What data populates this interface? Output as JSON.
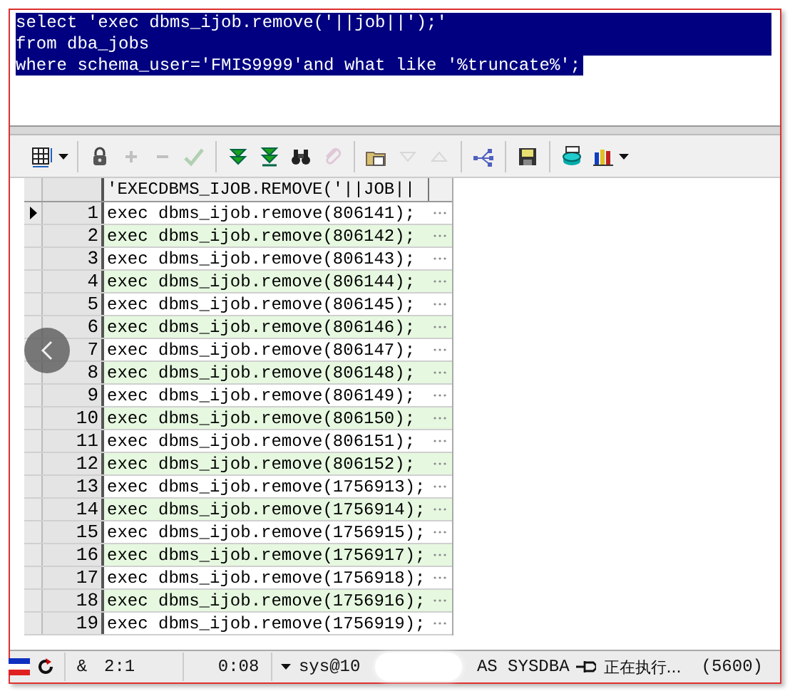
{
  "editor": {
    "lines": [
      {
        "text": "select 'exec dbms_ijob.remove('||job||');'",
        "selected": true
      },
      {
        "text": "from dba_jobs",
        "selected": true
      },
      {
        "text": "where schema_user='FMIS9999'and what like '%truncate%';",
        "selected": true
      }
    ]
  },
  "toolbar": {
    "groups": [
      [
        {
          "kind": "grid",
          "disabled": false,
          "dropdown": true
        }
      ],
      [
        {
          "kind": "lock",
          "disabled": false
        },
        {
          "kind": "plus",
          "disabled": true
        },
        {
          "kind": "minus",
          "disabled": true
        },
        {
          "kind": "check",
          "disabled": true
        }
      ],
      [
        {
          "kind": "fetch-next",
          "disabled": false
        },
        {
          "kind": "fetch-last",
          "disabled": false
        },
        {
          "kind": "binoculars",
          "disabled": false
        },
        {
          "kind": "clip",
          "disabled": true
        }
      ],
      [
        {
          "kind": "folder",
          "disabled": false
        },
        {
          "kind": "down",
          "disabled": true
        },
        {
          "kind": "up",
          "disabled": true
        }
      ],
      [
        {
          "kind": "network",
          "disabled": false
        }
      ],
      [
        {
          "kind": "save",
          "disabled": false
        }
      ],
      [
        {
          "kind": "database",
          "disabled": false
        },
        {
          "kind": "chart",
          "disabled": false,
          "dropdown": true
        }
      ]
    ]
  },
  "grid": {
    "columns": [
      "'EXECDBMS_IJOB.REMOVE('||JOB||"
    ],
    "rows": [
      {
        "number": "1",
        "value": "exec dbms_ijob.remove(806141);",
        "selected": true
      },
      {
        "number": "2",
        "value": "exec dbms_ijob.remove(806142);",
        "selected": false
      },
      {
        "number": "3",
        "value": "exec dbms_ijob.remove(806143);",
        "selected": false
      },
      {
        "number": "4",
        "value": "exec dbms_ijob.remove(806144);",
        "selected": false
      },
      {
        "number": "5",
        "value": "exec dbms_ijob.remove(806145);",
        "selected": false
      },
      {
        "number": "6",
        "value": "exec dbms_ijob.remove(806146);",
        "selected": false
      },
      {
        "number": "7",
        "value": "exec dbms_ijob.remove(806147);",
        "selected": false
      },
      {
        "number": "8",
        "value": "exec dbms_ijob.remove(806148);",
        "selected": false
      },
      {
        "number": "9",
        "value": "exec dbms_ijob.remove(806149);",
        "selected": false
      },
      {
        "number": "10",
        "value": "exec dbms_ijob.remove(806150);",
        "selected": false
      },
      {
        "number": "11",
        "value": "exec dbms_ijob.remove(806151);",
        "selected": false
      },
      {
        "number": "12",
        "value": "exec dbms_ijob.remove(806152);",
        "selected": false
      },
      {
        "number": "13",
        "value": "exec dbms_ijob.remove(1756913);",
        "selected": false
      },
      {
        "number": "14",
        "value": "exec dbms_ijob.remove(1756914);",
        "selected": false
      },
      {
        "number": "15",
        "value": "exec dbms_ijob.remove(1756915);",
        "selected": false
      },
      {
        "number": "16",
        "value": "exec dbms_ijob.remove(1756917);",
        "selected": false
      },
      {
        "number": "17",
        "value": "exec dbms_ijob.remove(1756918);",
        "selected": false
      },
      {
        "number": "18",
        "value": "exec dbms_ijob.remove(1756916);",
        "selected": false
      },
      {
        "number": "19",
        "value": "exec dbms_ijob.remove(1756919);",
        "selected": false
      }
    ]
  },
  "status_bar": {
    "symbol": "&",
    "position": "2:1",
    "elapsed": "0:08",
    "connection": "sys@10",
    "role": "AS SYSDBA",
    "message": "正在执行...",
    "count": "(5600)"
  }
}
